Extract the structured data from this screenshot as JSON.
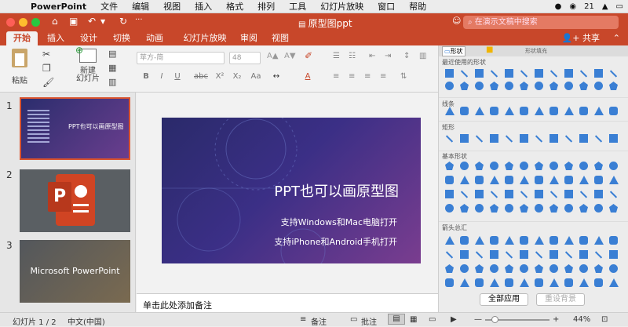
{
  "menubar": {
    "app": "PowerPoint",
    "items": [
      "文件",
      "编辑",
      "视图",
      "插入",
      "格式",
      "排列",
      "工具",
      "幻灯片放映",
      "窗口",
      "帮助"
    ],
    "battery": "21"
  },
  "window": {
    "title": "原型图ppt",
    "search_placeholder": "在演示文稿中搜索"
  },
  "tabs": [
    "开始",
    "插入",
    "设计",
    "切换",
    "动画",
    "幻灯片放映",
    "审阅",
    "视图"
  ],
  "share_label": "共享",
  "ribbon": {
    "paste": "粘贴",
    "new_slide": "新建\n幻灯片",
    "font_name": "苹方-简",
    "font_size": "48"
  },
  "thumbnails": [
    {
      "num": "1",
      "title": "PPT也可以画原型图"
    },
    {
      "num": "2"
    },
    {
      "num": "3",
      "title": "Microsoft PowerPoint"
    }
  ],
  "slide": {
    "title": "PPT也可以画原型图",
    "line1": "支持Windows和Mac电脑打开",
    "line2": "支持iPhone和Android手机打开"
  },
  "notes_placeholder": "单击此处添加备注",
  "shapes_panel": {
    "tab_shapes": "形状",
    "tab_fill": "形状填充",
    "sections": [
      "最近使用的形状",
      "线条",
      "矩形",
      "基本形状",
      "箭头总汇"
    ],
    "apply_all": "全部应用",
    "reset_bg": "重设背景"
  },
  "status": {
    "slide_info": "幻灯片 1 / 2",
    "language": "中文(中国)",
    "notes": "备注",
    "comments": "批注",
    "zoom": "44%"
  },
  "colors": {
    "accent": "#c8472a",
    "shape": "#3a7fd4"
  }
}
